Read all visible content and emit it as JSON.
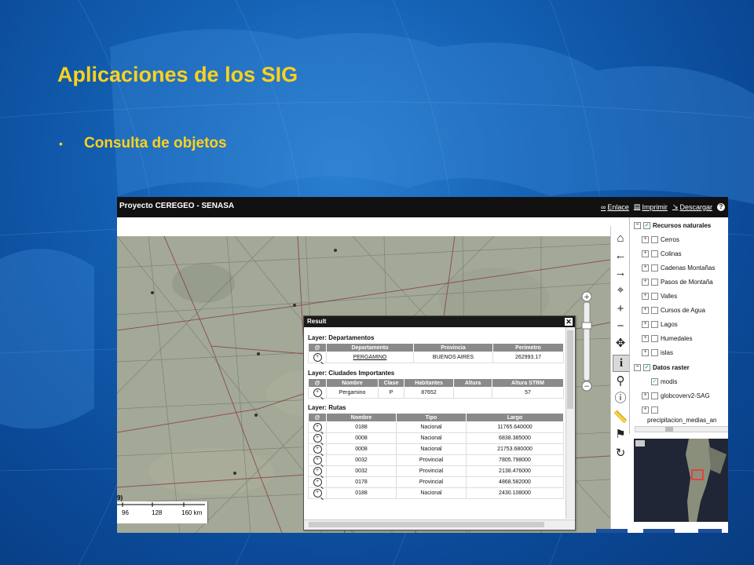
{
  "slide": {
    "title": "Aplicaciones de los SIG",
    "bullet": "Consulta de objetos"
  },
  "colors": {
    "title": "#ffd21a",
    "background": "#1461b4",
    "app_header": "#111111"
  },
  "app": {
    "title": "Proyecto CEREGEO - SENASA",
    "links": {
      "link": "Enlace",
      "print": "Imprimir",
      "download": "Descargar",
      "help": "?"
    }
  },
  "scale_bar": {
    "labels": [
      "96",
      "128",
      "160 km"
    ],
    "partial": "9)"
  },
  "toolbar_icons": [
    "home-icon",
    "back-arrow-icon",
    "forward-arrow-icon",
    "zoom-rect-icon",
    "zoom-in-plus-icon",
    "zoom-out-minus-icon",
    "pan-icon",
    "identify-icon",
    "query-icon",
    "info-icon",
    "measure-icon",
    "pin-icon",
    "refresh-icon"
  ],
  "layers": {
    "groups": [
      {
        "name": "Recursos naturales",
        "checked": true,
        "items": [
          {
            "name": "Cerros",
            "checked": false
          },
          {
            "name": "Colinas",
            "checked": false
          },
          {
            "name": "Cadenas Montañas",
            "checked": false
          },
          {
            "name": "Pasos de Montaña",
            "checked": false
          },
          {
            "name": "Valles",
            "checked": false
          },
          {
            "name": "Cursos de Agua",
            "checked": false
          },
          {
            "name": "Lagos",
            "checked": false
          },
          {
            "name": "Humedales",
            "checked": false
          },
          {
            "name": "islas",
            "checked": false
          }
        ]
      },
      {
        "name": "Datos raster",
        "checked": true,
        "items": [
          {
            "name": "modis",
            "checked": true
          },
          {
            "name": "globcoverv2-SAG",
            "checked": false
          },
          {
            "name": "precipitacion_medias_an",
            "checked": false
          }
        ]
      }
    ]
  },
  "result": {
    "title": "Result",
    "departamentos": {
      "label": "Layer: Departamentos",
      "headers": [
        "@",
        "Departamento",
        "Provincia",
        "Perimetro"
      ],
      "rows": [
        [
          "PERGAMINO",
          "BUENOS AIRES",
          "262993.17"
        ]
      ]
    },
    "ciudades": {
      "label": "Layer: Ciudades Importantes",
      "headers": [
        "@",
        "Nombre",
        "Clase",
        "Habitantes",
        "Altura",
        "Altura STRM"
      ],
      "rows": [
        [
          "Pergamino",
          "P",
          "87652",
          "",
          "57"
        ]
      ]
    },
    "rutas": {
      "label": "Layer: Rutas",
      "headers": [
        "@",
        "Nombre",
        "Tipo",
        "Largo"
      ],
      "rows": [
        [
          "0188",
          "Nacional",
          "11765.640000"
        ],
        [
          "0008",
          "Nacional",
          "6838.385000"
        ],
        [
          "0008",
          "Nacional",
          "21753.680000"
        ],
        [
          "0032",
          "Provincial",
          "7805.798000"
        ],
        [
          "0032",
          "Provincial",
          "2138.476000"
        ],
        [
          "0178",
          "Provincial",
          "4868.582000"
        ],
        [
          "0188",
          "Nacional",
          "2430.108000"
        ]
      ]
    }
  }
}
